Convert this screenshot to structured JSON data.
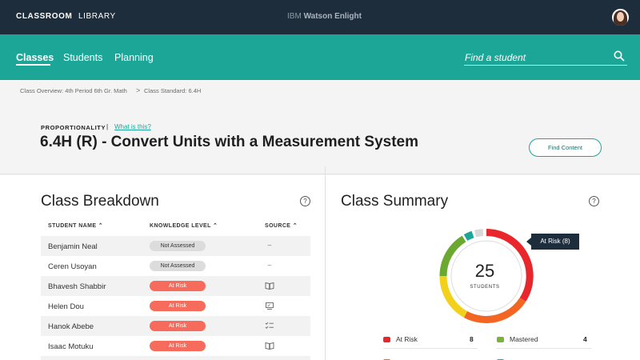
{
  "topbar": {
    "nav": [
      "CLASSROOM",
      "LIBRARY"
    ],
    "brand_prefix": "IBM",
    "brand_name": "Watson Enlight"
  },
  "subnav": {
    "tabs": [
      "Classes",
      "Students",
      "Planning"
    ],
    "active_tab": "Classes",
    "search_placeholder": "Find a student"
  },
  "breadcrumb": {
    "items": [
      "Class Overview: 4th Period 6th Gr. Math",
      "Class Standard: 6.4H"
    ],
    "separator": ">"
  },
  "header": {
    "kicker": "PROPORTIONALITY",
    "kicker_divider": "|",
    "what_link": "What is this?",
    "title": "6.4H (R) - Convert Units with a Measurement System",
    "find_button": "Find Content"
  },
  "breakdown": {
    "title": "Class Breakdown",
    "help": "?",
    "columns": [
      "STUDENT NAME",
      "KNOWLEDGE LEVEL",
      "SOURCE"
    ],
    "rows": [
      {
        "name": "Benjamin Neal",
        "level": "Not Assessed",
        "source": "–"
      },
      {
        "name": "Ceren Usoyan",
        "level": "Not Assessed",
        "source": "–"
      },
      {
        "name": "Bhavesh Shabbir",
        "level": "At Risk",
        "source": "book"
      },
      {
        "name": "Helen Dou",
        "level": "At Risk",
        "source": "chalkboard"
      },
      {
        "name": "Hanok Abebe",
        "level": "At Risk",
        "source": "checklist"
      },
      {
        "name": "Isaac Motuku",
        "level": "At Risk",
        "source": "book"
      }
    ]
  },
  "summary": {
    "title": "Class Summary",
    "help": "?",
    "total": "25",
    "total_label": "STUDENTS",
    "tooltip": "At Risk (8)",
    "colors": {
      "at_risk": "#e8262b",
      "orange": "#f26522",
      "yellow": "#f1d11c",
      "mastered": "#6aa832",
      "teal": "#1ba698",
      "gray": "#d9d9d9"
    },
    "legend": [
      {
        "label": "At Risk",
        "count": "8",
        "color": "#e8262b"
      },
      {
        "label": "Mastered",
        "count": "4",
        "color": "#7ab33c"
      }
    ]
  }
}
